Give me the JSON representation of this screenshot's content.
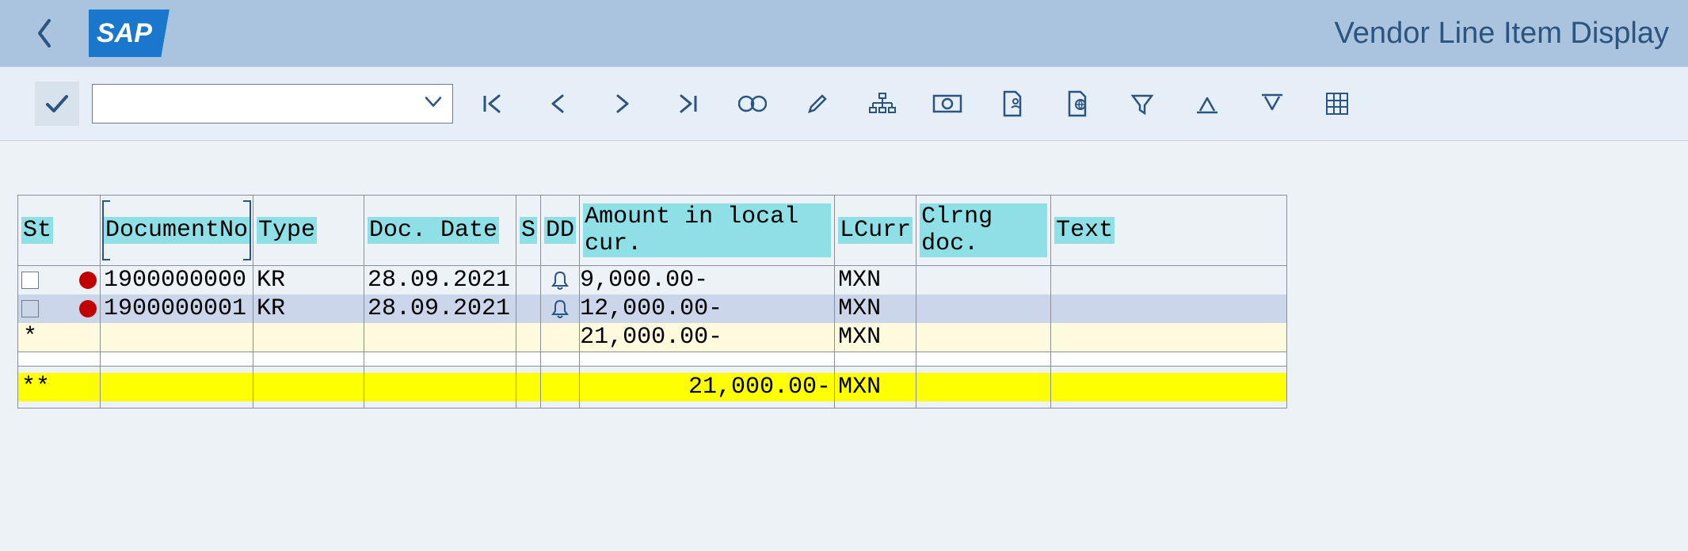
{
  "header": {
    "logo_text": "SAP",
    "page_title": "Vendor Line Item Display"
  },
  "toolbar": {
    "combo_value": ""
  },
  "columns": {
    "st": "St",
    "docno": "DocumentNo",
    "type": "Type",
    "date": "Doc. Date",
    "s": "S",
    "dd": "DD",
    "amount": "Amount in local cur.",
    "lcurr": "LCurr",
    "clrng": "Clrng doc.",
    "text": "Text"
  },
  "rows": [
    {
      "status": "open",
      "selected": false,
      "docno": "1900000000",
      "type": "KR",
      "date": "28.09.2021",
      "s": "",
      "dd": "bell",
      "amount": "9,000.00-",
      "lcurr": "MXN",
      "clrng": "",
      "text": ""
    },
    {
      "status": "open",
      "selected": true,
      "docno": "1900000001",
      "type": "KR",
      "date": "28.09.2021",
      "s": "",
      "dd": "bell",
      "amount": "12,000.00-",
      "lcurr": "MXN",
      "clrng": "",
      "text": ""
    }
  ],
  "subtotal": {
    "marker": "*",
    "amount": "21,000.00-",
    "lcurr": "MXN"
  },
  "grandtotal": {
    "marker": "**",
    "amount": "21,000.00-",
    "lcurr": "MXN"
  }
}
